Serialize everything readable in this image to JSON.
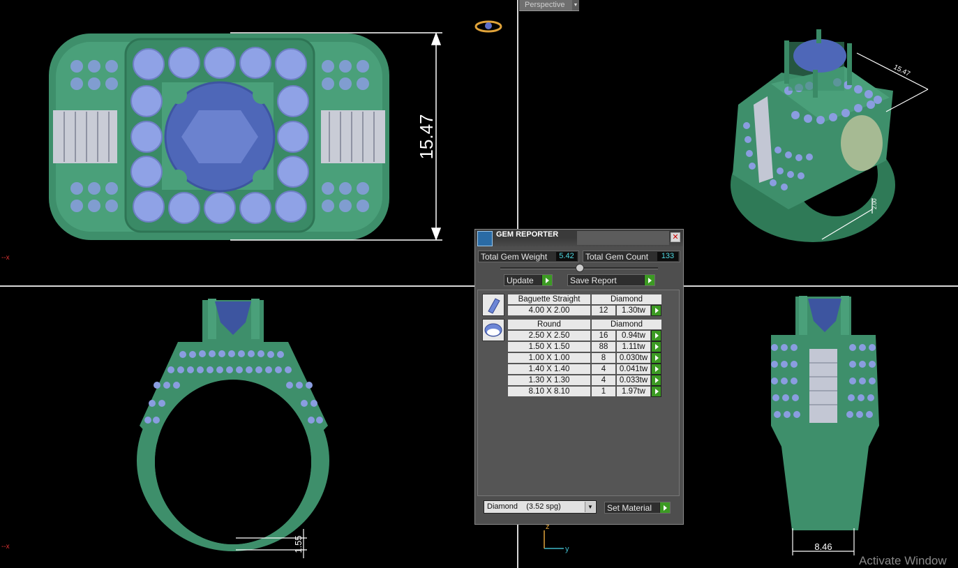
{
  "viewport": {
    "perspective_label": "Perspective",
    "axis_x": "x",
    "axis_z": "z",
    "axis_y": "y"
  },
  "dimensions": {
    "top_height": "15.47",
    "perspective_dim_1": "15.47",
    "perspective_dim_2": "2.00",
    "shank_thickness": "1.55",
    "side_width": "8.46"
  },
  "gem_reporter": {
    "title": "GEM REPORTER",
    "total_weight_label": "Total Gem Weight",
    "total_weight_value": "5.42",
    "total_count_label": "Total Gem Count",
    "total_count_value": "133",
    "update_label": "Update",
    "save_report_label": "Save Report",
    "groups": [
      {
        "shape": "Baguette Straight",
        "material": "Diamond",
        "icon": "baguette-gem-icon",
        "rows": [
          {
            "size": "4.00 X 2.00",
            "count": "12",
            "weight": "1.30tw"
          }
        ]
      },
      {
        "shape": "Round",
        "material": "Diamond",
        "icon": "round-gem-icon",
        "rows": [
          {
            "size": "2.50 X 2.50",
            "count": "16",
            "weight": "0.94tw"
          },
          {
            "size": "1.50 X 1.50",
            "count": "88",
            "weight": "1.11tw"
          },
          {
            "size": "1.00 X 1.00",
            "count": "8",
            "weight": "0.030tw"
          },
          {
            "size": "1.40 X 1.40",
            "count": "4",
            "weight": "0.041tw"
          },
          {
            "size": "1.30 X 1.30",
            "count": "4",
            "weight": "0.033tw"
          },
          {
            "size": "8.10 X 8.10",
            "count": "1",
            "weight": "1.97tw"
          }
        ]
      }
    ],
    "material_select": "Diamond    (3.52 spg)",
    "set_material_label": "Set Material"
  },
  "watermark": "Activate Window",
  "colors": {
    "background": "#000000",
    "metal": "#3e8f6b",
    "gem": "#8a9de0",
    "accent_green": "#3c9a23",
    "value_cyan": "#4fd7e0"
  }
}
